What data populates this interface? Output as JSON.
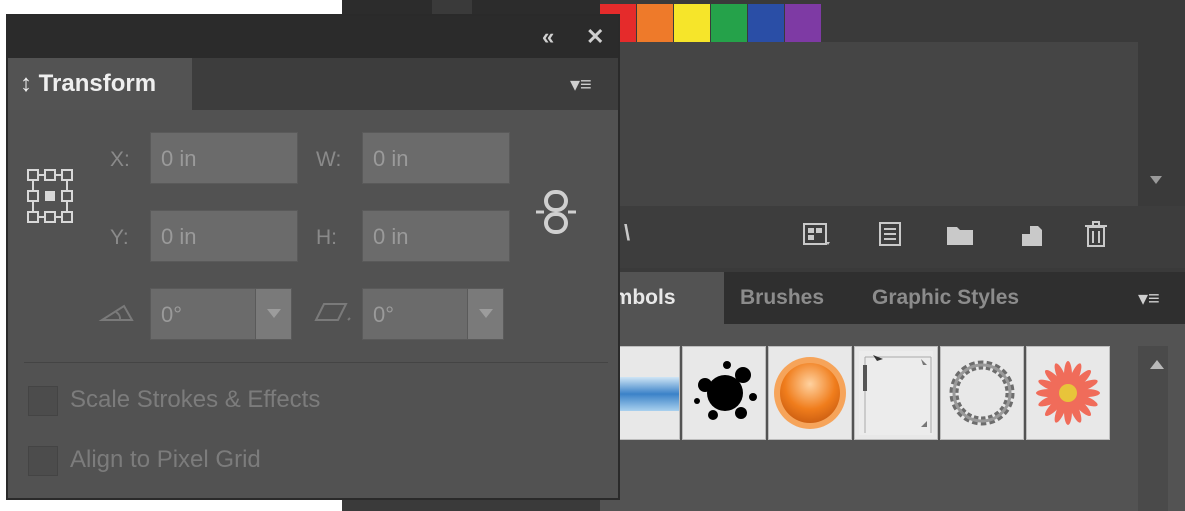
{
  "background_app": {
    "swatch_colors": [
      "#e52b2b",
      "#ee7a2a",
      "#f6e52a",
      "#25a24a",
      "#2a4ea6",
      "#7e3aa4"
    ],
    "toolbar_glyph": "\\",
    "toolbar_icons": [
      "new-swatch-group-icon",
      "swatch-options-icon",
      "folder-icon",
      "new-swatch-icon",
      "trash-icon"
    ],
    "tabs": [
      {
        "label": "ymbols",
        "active": true
      },
      {
        "label": "Brushes",
        "active": false
      },
      {
        "label": "Graphic Styles",
        "active": false
      }
    ],
    "symbols": [
      "blue-bar-symbol",
      "ink-splat-symbol",
      "orange-button-symbol",
      "cursor-frame-symbol",
      "rope-ring-symbol",
      "daisy-flower-symbol"
    ]
  },
  "panel": {
    "collapse_label": "«",
    "close_label": "✕",
    "tab_label": "Transform",
    "tab_arrow": "↕",
    "menu_glyph": "▾≡",
    "x_label": "X:",
    "x_value": "0 in",
    "y_label": "Y:",
    "y_value": "0 in",
    "w_label": "W:",
    "w_value": "0 in",
    "h_label": "H:",
    "h_value": "0 in",
    "rotate_value": "0°",
    "shear_value": "0°",
    "scale_strokes_label": "Scale Strokes & Effects",
    "align_pixel_label": "Align to Pixel Grid"
  }
}
